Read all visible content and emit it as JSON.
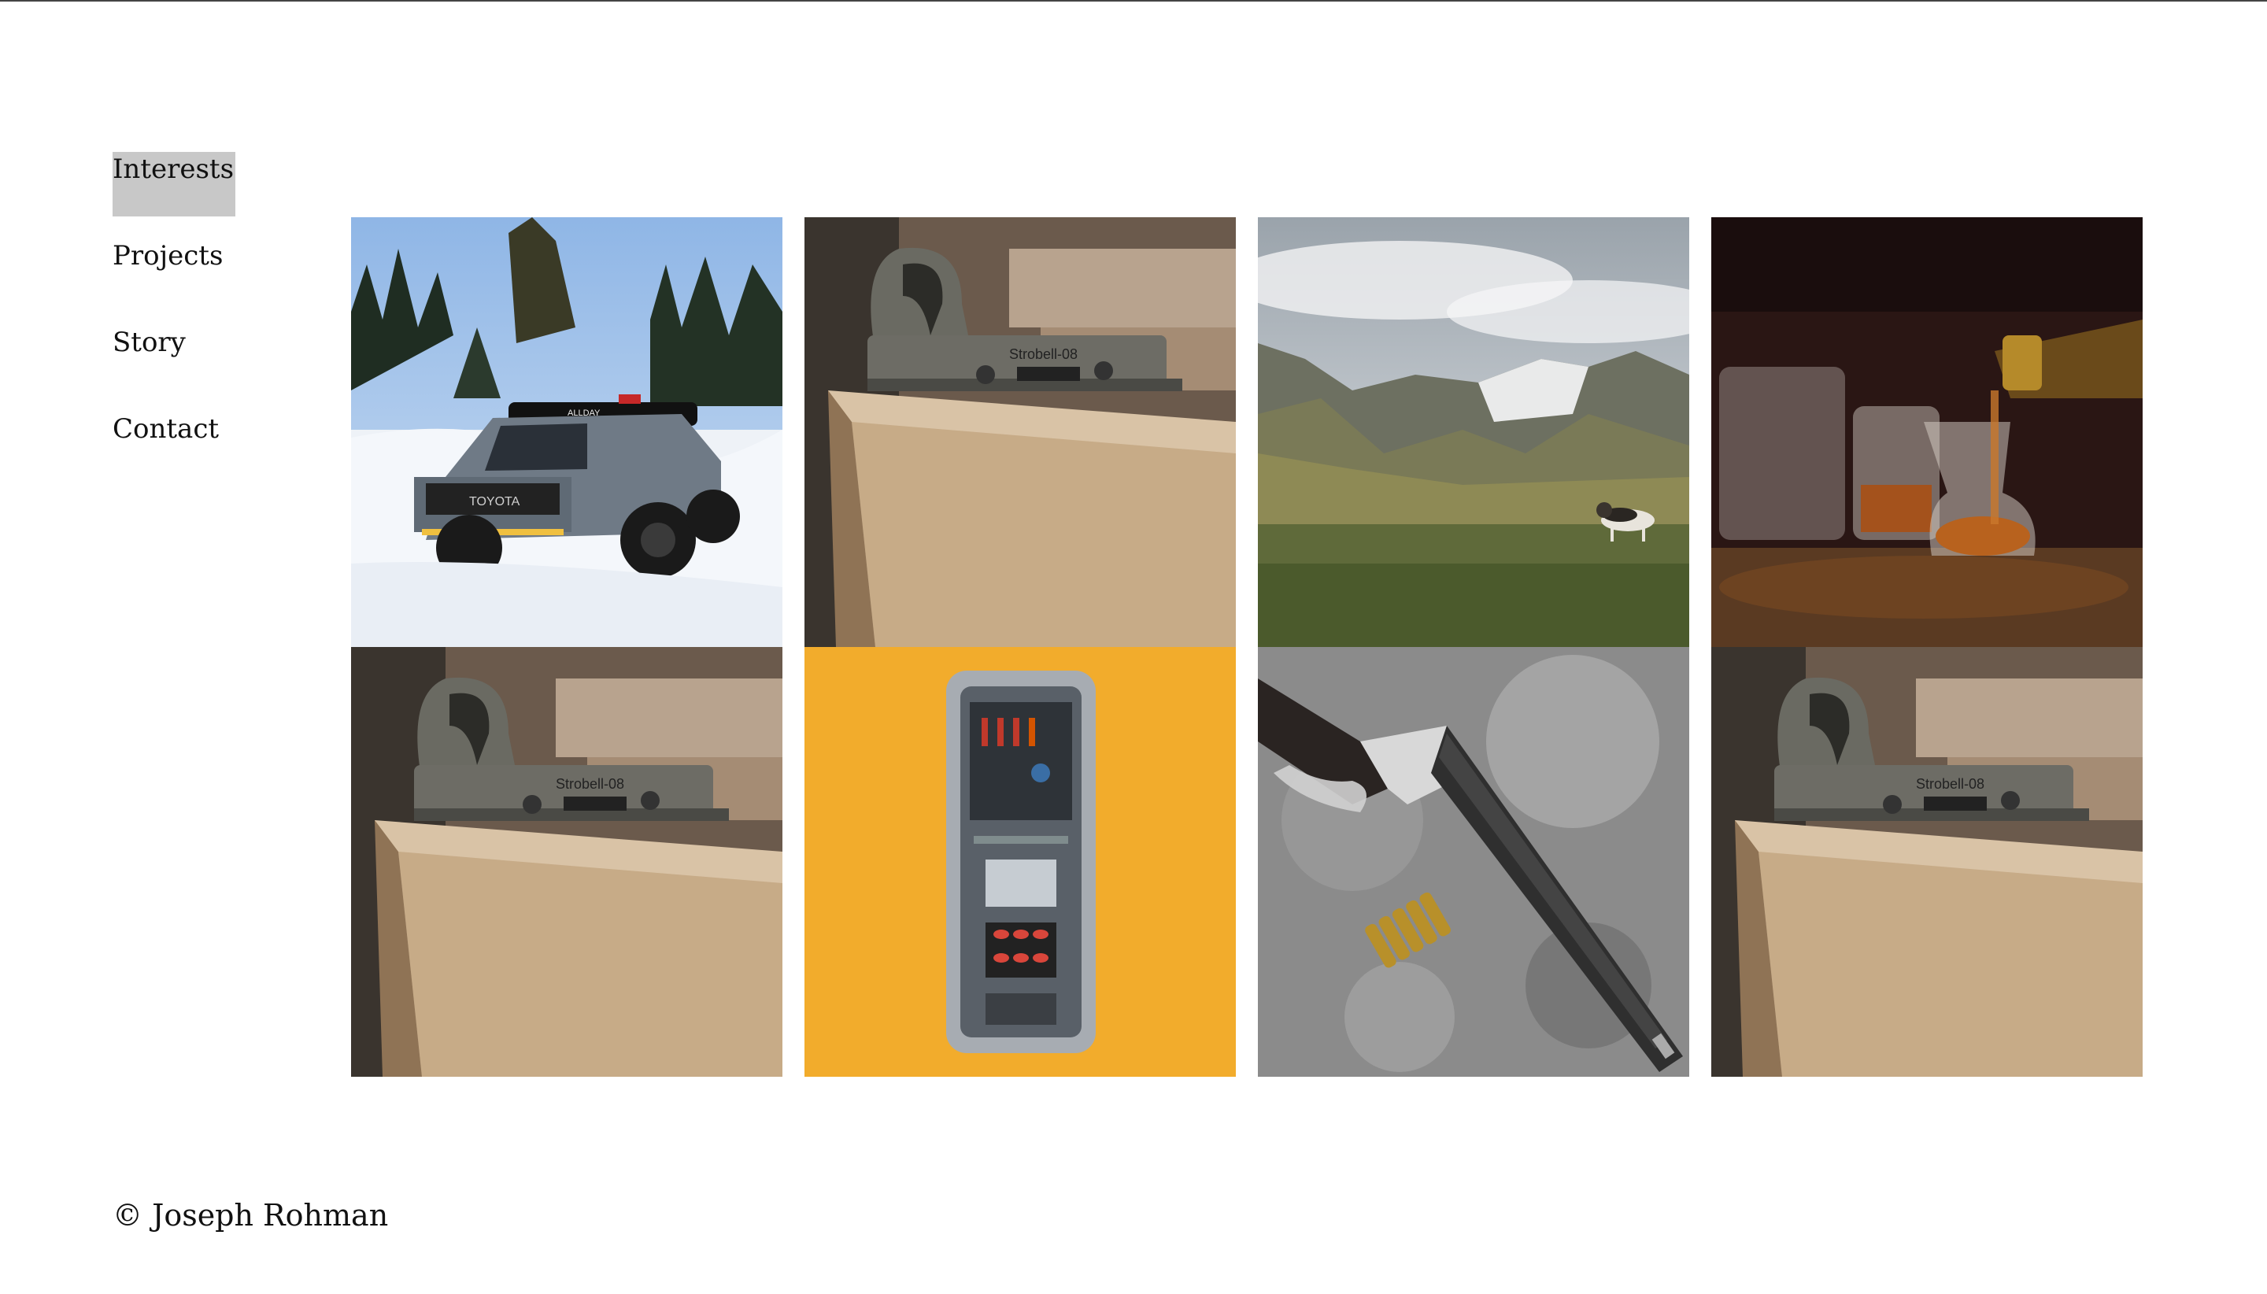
{
  "nav": {
    "items": [
      {
        "label": "Interests",
        "active": true
      },
      {
        "label": "Projects",
        "active": false
      },
      {
        "label": "Story",
        "active": false
      },
      {
        "label": "Contact",
        "active": false
      }
    ]
  },
  "gallery": {
    "tiles": [
      {
        "subject": "truck-in-snow",
        "truck_grille_text": "TOYOTA",
        "lightbar_text": "ALLDAY"
      },
      {
        "subject": "woodworking-plane",
        "plane_stamp_text": "Strobell-08"
      },
      {
        "subject": "mountain-landscape-with-dog"
      },
      {
        "subject": "whisky-pouring"
      },
      {
        "subject": "woodworking-plane",
        "plane_stamp_text": "Strobell-08"
      },
      {
        "subject": "guitar-pedal-circuit"
      },
      {
        "subject": "lever-action-rifle-with-cartridges"
      },
      {
        "subject": "woodworking-plane",
        "plane_stamp_text": "Strobell-08"
      }
    ]
  },
  "colors": {
    "active_nav_bg": "#c8c8c8",
    "pedal_background": "#f2ac2c"
  },
  "footer": {
    "copyright": "© Joseph Rohman"
  }
}
